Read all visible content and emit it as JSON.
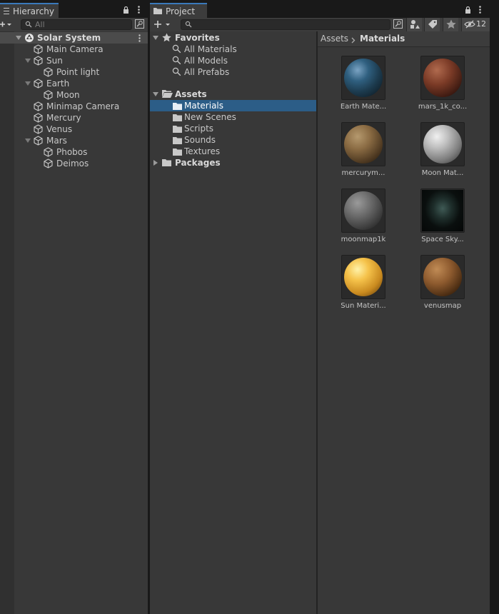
{
  "hierarchy": {
    "tab_label": "Hierarchy",
    "search_placeholder": "All",
    "scene": "Solar System",
    "items": [
      {
        "label": "Main Camera",
        "depth": 1
      },
      {
        "label": "Sun",
        "depth": 1,
        "expanded": true
      },
      {
        "label": "Point light",
        "depth": 2
      },
      {
        "label": "Earth",
        "depth": 1,
        "expanded": true
      },
      {
        "label": "Moon",
        "depth": 2
      },
      {
        "label": "Minimap Camera",
        "depth": 1
      },
      {
        "label": "Mercury",
        "depth": 1
      },
      {
        "label": "Venus",
        "depth": 1
      },
      {
        "label": "Mars",
        "depth": 1,
        "expanded": true
      },
      {
        "label": "Phobos",
        "depth": 2
      },
      {
        "label": "Deimos",
        "depth": 2
      }
    ]
  },
  "project": {
    "tab_label": "Project",
    "hidden_count": "12",
    "tree": {
      "favorites": {
        "label": "Favorites",
        "items": [
          "All Materials",
          "All Models",
          "All Prefabs"
        ]
      },
      "assets": {
        "label": "Assets",
        "items": [
          "Materials",
          "New Scenes",
          "Scripts",
          "Sounds",
          "Textures"
        ],
        "selected": "Materials"
      },
      "packages": {
        "label": "Packages"
      }
    },
    "breadcrumb": {
      "root": "Assets",
      "current": "Materials"
    },
    "assets_grid": [
      {
        "label": "Earth Mate...",
        "icon": "earth-material-icon"
      },
      {
        "label": "mars_1k_co...",
        "icon": "mars-material-icon"
      },
      {
        "label": "mercurym...",
        "icon": "mercury-material-icon"
      },
      {
        "label": "Moon Mat...",
        "icon": "moon-material-icon"
      },
      {
        "label": "moonmap1k",
        "icon": "moonmap-texture-icon"
      },
      {
        "label": "Space Sky...",
        "icon": "space-skybox-icon"
      },
      {
        "label": "Sun Materi...",
        "icon": "sun-material-icon"
      },
      {
        "label": "venusmap",
        "icon": "venus-material-icon"
      }
    ]
  },
  "colors": {
    "selection": "#2c5d87",
    "tab_accent": "#3a79bb",
    "panel_bg": "#383838"
  }
}
